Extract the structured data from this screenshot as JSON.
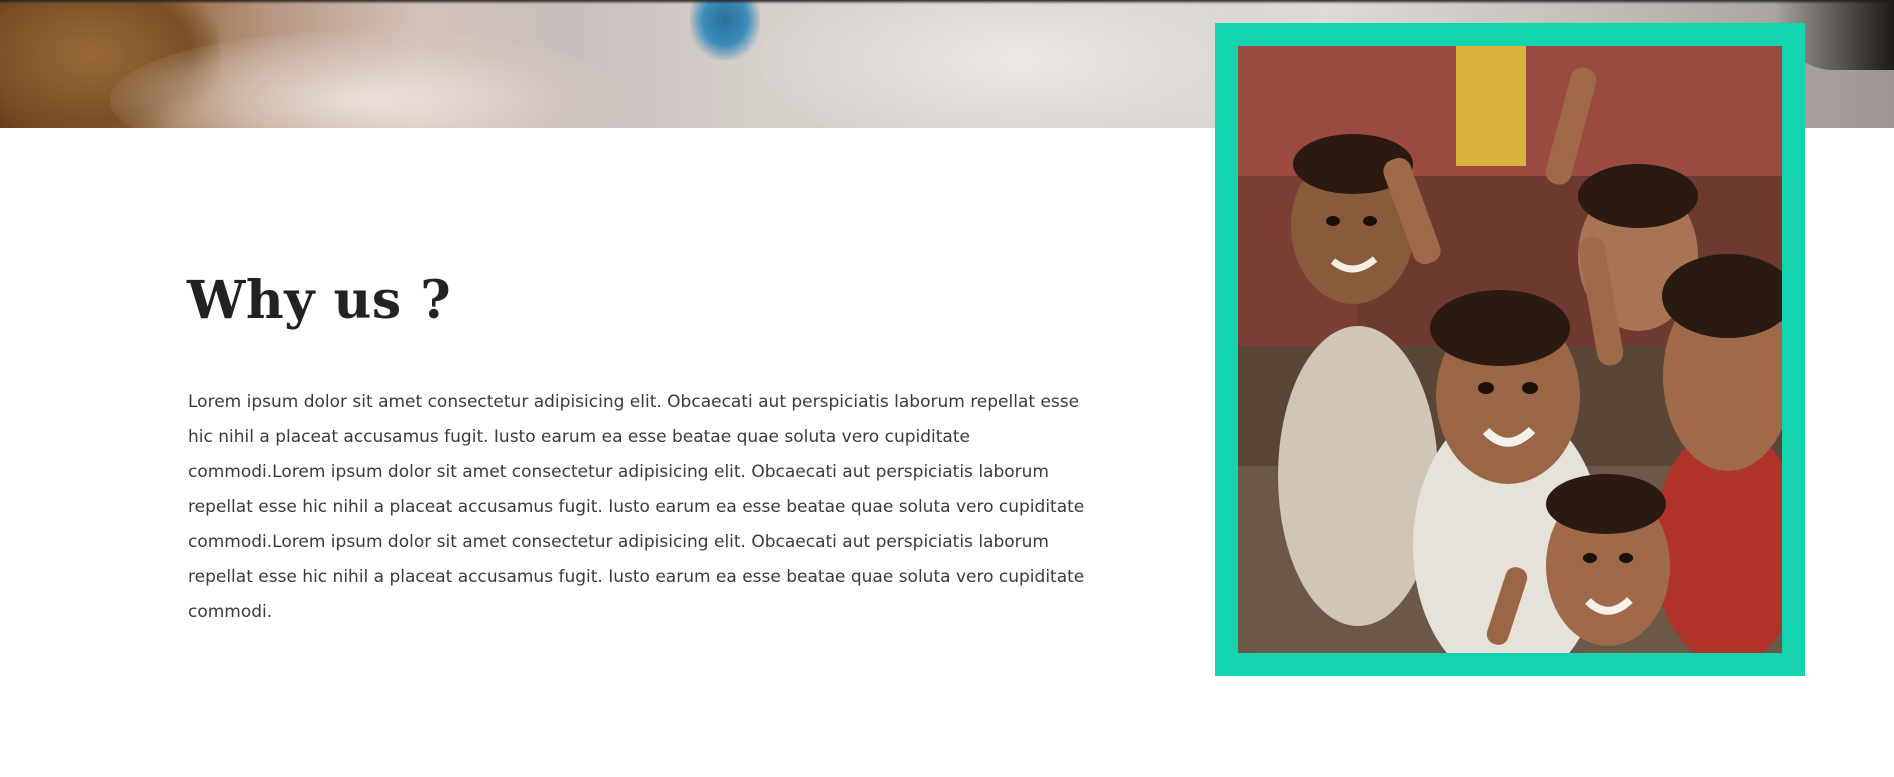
{
  "section": {
    "title": "Why us ?",
    "body": "Lorem ipsum dolor sit amet consectetur adipisicing elit. Obcaecati aut perspiciatis laborum repellat esse hic nihil a placeat accusamus fugit. Iusto earum ea esse beatae quae soluta vero cupiditate commodi.Lorem ipsum dolor sit amet consectetur adipisicing elit. Obcaecati aut perspiciatis laborum repellat esse hic nihil a placeat accusamus fugit. Iusto earum ea esse beatae quae soluta vero cupiditate commodi.Lorem ipsum dolor sit amet consectetur adipisicing elit. Obcaecati aut perspiciatis laborum repellat esse hic nihil a placeat accusamus fugit. Iusto earum ea esse beatae quae soluta vero cupiditate commodi."
  },
  "colors": {
    "frame_accent": "#14d4b0",
    "heading": "#222222",
    "body_text": "#3a3a3a",
    "background": "#ffffff"
  }
}
